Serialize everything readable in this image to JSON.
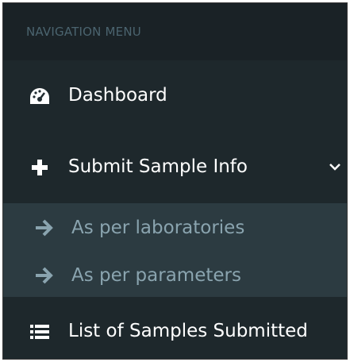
{
  "sidebar": {
    "header": "NAVIGATION MENU",
    "items": [
      {
        "label": "Dashboard",
        "icon": "dashboard-icon"
      },
      {
        "label": "Submit Sample Info",
        "icon": "plus-icon",
        "expanded": true
      },
      {
        "label": "List of Samples Submitted",
        "icon": "list-icon"
      }
    ],
    "submenu": [
      {
        "label": "As per laboratories",
        "icon": "arrow-right-icon"
      },
      {
        "label": "As per parameters",
        "icon": "arrow-right-icon"
      }
    ]
  },
  "colors": {
    "sidebar_bg": "#222d32",
    "header_bg": "#1a2226",
    "submenu_bg": "#2c3b41",
    "accent": "#3c8dbc",
    "submenu_text": "#8aa4af"
  }
}
